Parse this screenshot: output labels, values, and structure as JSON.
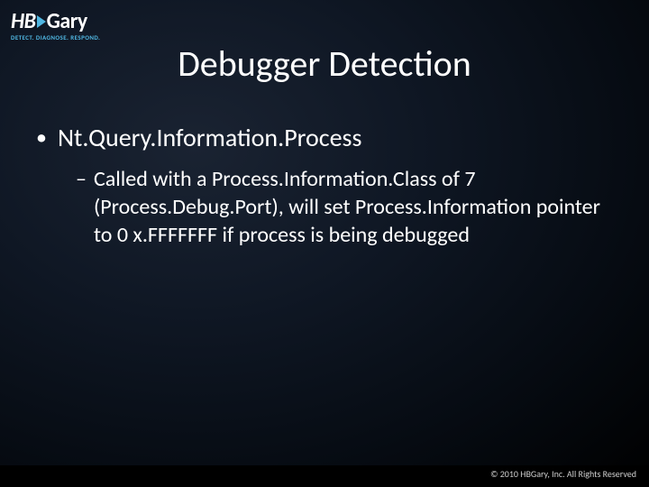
{
  "logo": {
    "hb": "HB",
    "gary": "Gary",
    "tagline": "DETECT. DIAGNOSE. RESPOND."
  },
  "title": "Debugger Detection",
  "bullets": {
    "level1": "Nt.Query.Information.Process",
    "level2": "Called with a Process.Information.Class of 7 (Process.Debug.Port), will set Process.Information pointer to 0 x.FFFFFFF if process is being debugged"
  },
  "footer": "© 2010 HBGary, Inc. All Rights Reserved"
}
